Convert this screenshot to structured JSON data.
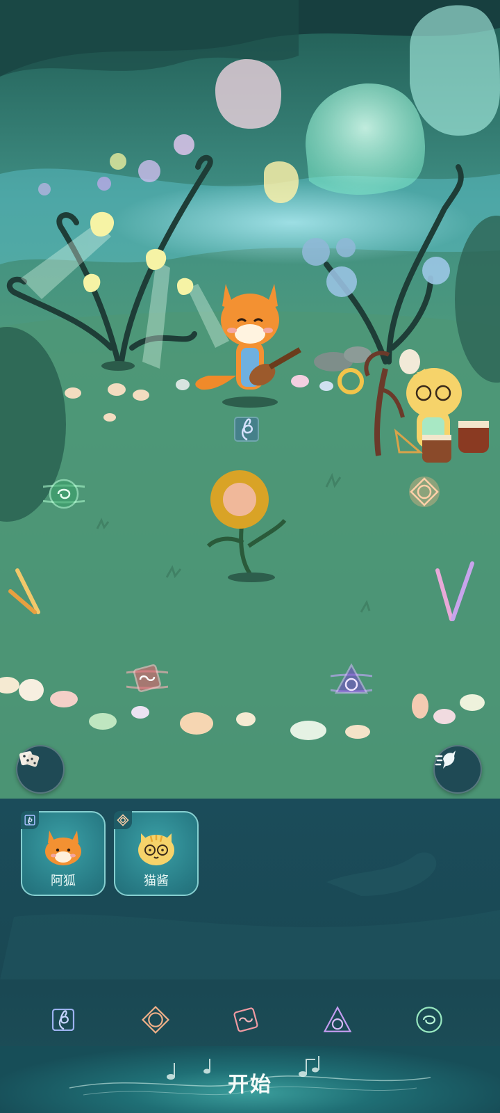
{
  "characters": [
    {
      "name": "阿狐",
      "instrument_icon": "treble-clef-rune-icon",
      "avatar": "fox-avatar"
    },
    {
      "name": "猫酱",
      "instrument_icon": "diamond-rune-icon",
      "avatar": "cat-avatar"
    }
  ],
  "buttons": {
    "random": {
      "icon": "dice-icon"
    },
    "speed": {
      "icon": "running-spirit-icon"
    }
  },
  "stage_slots": [
    {
      "rune": "treble-clef-rune-icon",
      "color": "#8fb2ff",
      "state": "occupied"
    },
    {
      "rune": "diamond-rune-icon",
      "color": "#ffb47a",
      "state": "occupied"
    },
    {
      "rune": "green-swirl-rune-icon",
      "color": "#7cf0b0",
      "state": "empty"
    },
    {
      "rune": "pink-tablet-rune-icon",
      "color": "#ff8a94",
      "state": "empty"
    },
    {
      "rune": "purple-triangle-rune-icon",
      "color": "#b07cff",
      "state": "empty"
    }
  ],
  "tabs": [
    {
      "icon": "treble-clef-rune-icon",
      "color": "#9db2f0"
    },
    {
      "icon": "diamond-rune-icon",
      "color": "#f0b088"
    },
    {
      "icon": "pink-tablet-rune-icon",
      "color": "#f09aa2"
    },
    {
      "icon": "purple-triangle-rune-icon",
      "color": "#c39cf0"
    },
    {
      "icon": "green-swirl-rune-icon",
      "color": "#98e8c0"
    }
  ],
  "start": {
    "label": "开始"
  }
}
